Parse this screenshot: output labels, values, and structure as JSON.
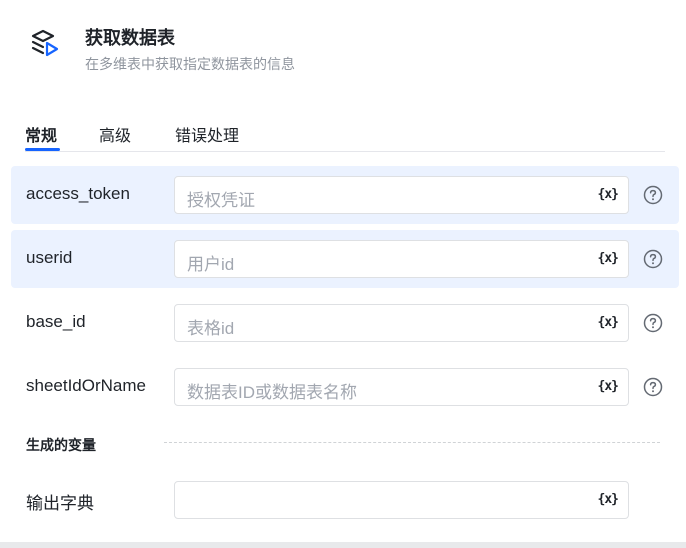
{
  "header": {
    "title": "获取数据表",
    "description": "在多维表中获取指定数据表的信息",
    "logo_icon": "layers-play-icon"
  },
  "tabs": [
    {
      "label": "常规",
      "active": true
    },
    {
      "label": "高级",
      "active": false
    },
    {
      "label": "错误处理",
      "active": false
    }
  ],
  "fields": [
    {
      "label": "access_token",
      "placeholder": "授权凭证",
      "highlighted": true
    },
    {
      "label": "userid",
      "placeholder": "用户id",
      "highlighted": true
    },
    {
      "label": "base_id",
      "placeholder": "表格id",
      "highlighted": false
    },
    {
      "label": "sheetIdOrName",
      "placeholder": "数据表ID或数据表名称",
      "highlighted": false
    }
  ],
  "variable_button_label": "{x}",
  "output_section": {
    "title": "生成的变量",
    "field": {
      "label": "输出字典",
      "value": ""
    }
  },
  "colors": {
    "accent": "#1664ff",
    "row_highlight": "#ebf2ff"
  }
}
